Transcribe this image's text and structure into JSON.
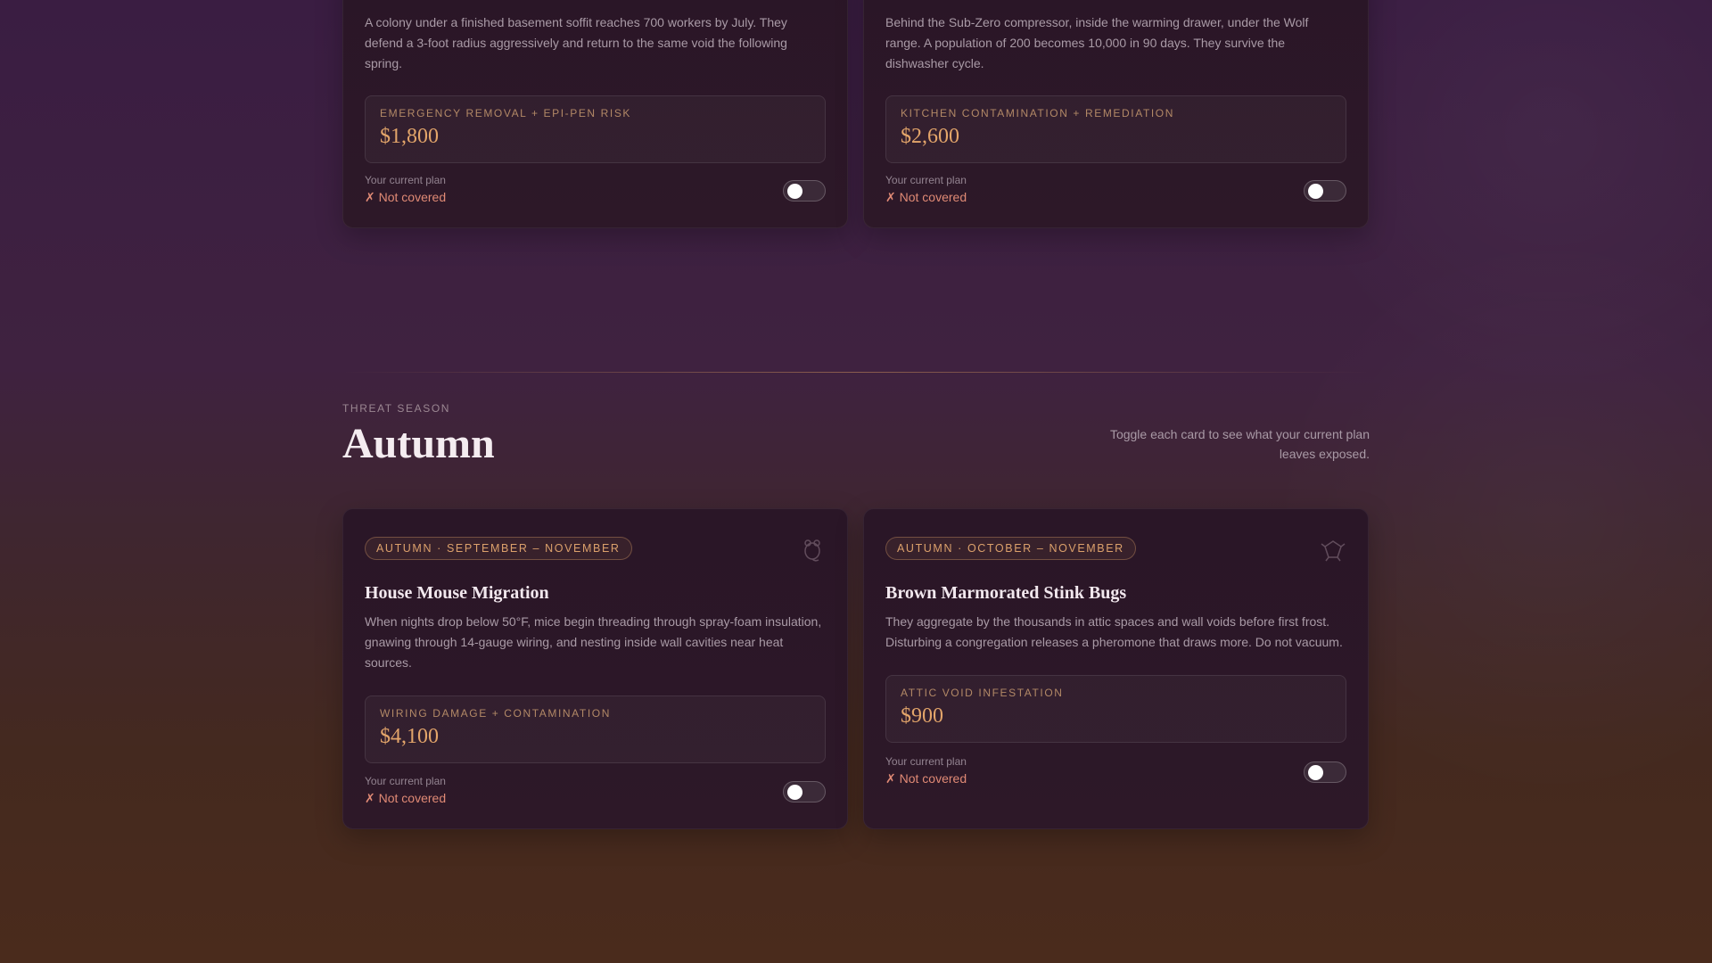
{
  "top_cards": [
    {
      "description": "A colony under a finished basement soffit reaches 700 workers by July. They defend a 3-foot radius aggressively and return to the same void the following spring.",
      "cost_label": "EMERGENCY REMOVAL + EPI-PEN RISK",
      "cost_value": "$1,800",
      "plan_label": "Your current plan",
      "plan_status": "✗ Not covered"
    },
    {
      "description": "Behind the Sub-Zero compressor, inside the warming drawer, under the Wolf range. A population of 200 becomes 10,000 in 90 days. They survive the dishwasher cycle.",
      "cost_label": "KITCHEN CONTAMINATION + REMEDIATION",
      "cost_value": "$2,600",
      "plan_label": "Your current plan",
      "plan_status": "✗ Not covered"
    }
  ],
  "section": {
    "eyebrow": "THREAT SEASON",
    "title": "Autumn",
    "hint": "Toggle each card to see what your current plan leaves exposed."
  },
  "autumn_cards": [
    {
      "badge": "AUTUMN · SEPTEMBER – NOVEMBER",
      "icon": "mouse-icon",
      "title": "House Mouse Migration",
      "description": "When nights drop below 50°F, mice begin threading through spray-foam insulation, gnawing through 14-gauge wiring, and nesting inside wall cavities near heat sources.",
      "cost_label": "WIRING DAMAGE + CONTAMINATION",
      "cost_value": "$4,100",
      "plan_label": "Your current plan",
      "plan_status": "✗ Not covered"
    },
    {
      "badge": "AUTUMN · OCTOBER – NOVEMBER",
      "icon": "stink-bug-icon",
      "title": "Brown Marmorated Stink Bugs",
      "description": "They aggregate by the thousands in attic spaces and wall voids before first frost. Disturbing a congregation releases a pheromone that draws more. Do not vacuum.",
      "cost_label": "ATTIC VOID INFESTATION",
      "cost_value": "$900",
      "plan_label": "Your current plan",
      "plan_status": "✗ Not covered"
    }
  ],
  "colors": {
    "accent": "#e3a56a",
    "not_covered": "#e08a75",
    "card_bg": "#2a1627"
  }
}
